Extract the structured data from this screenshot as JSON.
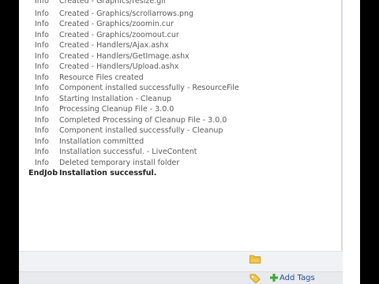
{
  "log": {
    "rows": [
      {
        "type": "Info",
        "message": "Created - Graphics/resize.gif"
      },
      {
        "type": "Info",
        "message": "Created - Graphics/scrollarrows.png"
      },
      {
        "type": "Info",
        "message": "Created - Graphics/zoomin.cur"
      },
      {
        "type": "Info",
        "message": "Created - Graphics/zoomout.cur"
      },
      {
        "type": "Info",
        "message": "Created - Handlers/Ajax.ashx"
      },
      {
        "type": "Info",
        "message": "Created - Handlers/GetImage.ashx"
      },
      {
        "type": "Info",
        "message": "Created - Handlers/Upload.ashx"
      },
      {
        "type": "Info",
        "message": "Resource Files created"
      },
      {
        "type": "Info",
        "message": "Component installed successfully - ResourceFile"
      },
      {
        "type": "Info",
        "message": "Starting Installation - Cleanup"
      },
      {
        "type": "Info",
        "message": "Processing Cleanup File - 3.0.0"
      },
      {
        "type": "Info",
        "message": "Completed Processing of Cleanup File - 3.0.0"
      },
      {
        "type": "Info",
        "message": "Component installed successfully - Cleanup"
      },
      {
        "type": "Info",
        "message": "Installation committed"
      },
      {
        "type": "Info",
        "message": "Installation successful. - LiveContent"
      },
      {
        "type": "Info",
        "message": "Deleted temporary install folder"
      },
      {
        "type": "EndJob",
        "message": "Installation successful."
      }
    ]
  },
  "footer": {
    "folder_icon": "folder-icon",
    "tag_icon": "tag-icon",
    "add_tags_icon": "plus-icon",
    "add_tags_label": "Add Tags"
  },
  "colors": {
    "log_text": "#5a5a5a",
    "link": "#1f4e99",
    "footer_bg": "#f1f2f4"
  }
}
